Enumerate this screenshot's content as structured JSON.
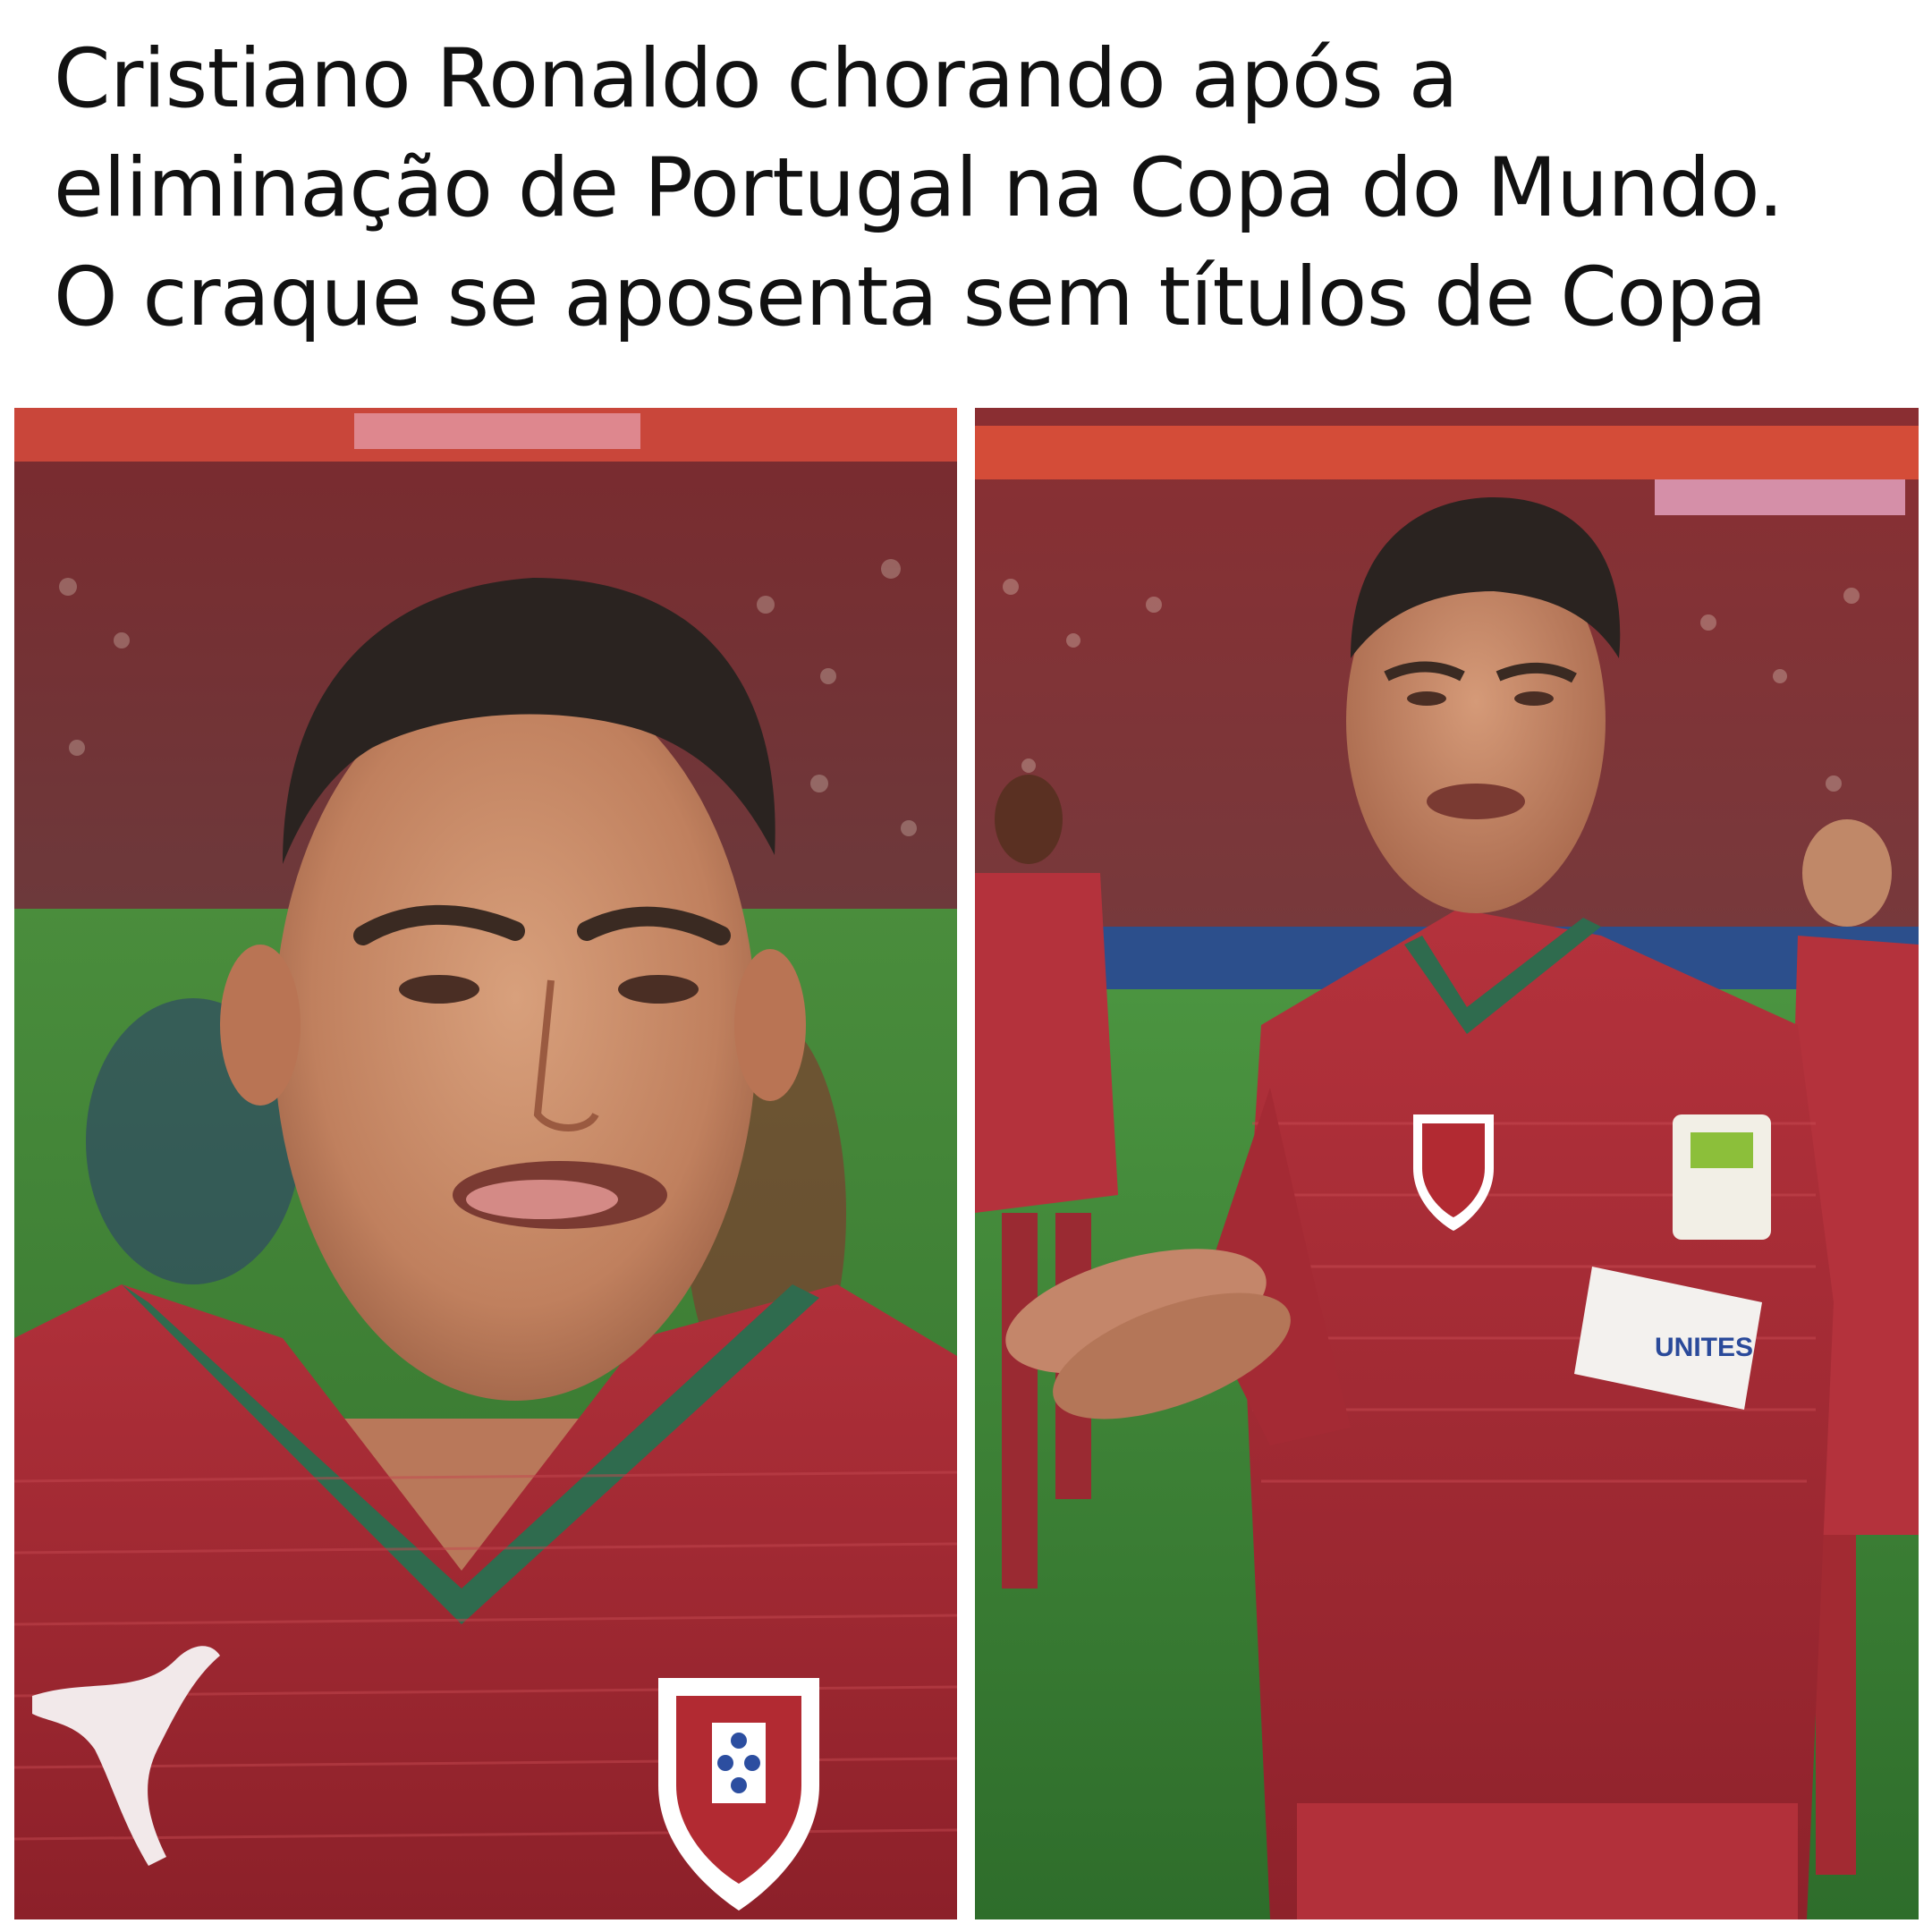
{
  "post": {
    "caption_lines": [
      "Cristiano Ronaldo chorando após a",
      "eliminação de Portugal na Copa do Mundo.",
      "O craque se aposenta sem títulos de Copa"
    ]
  },
  "photos": [
    {
      "subject": "close-up of Cristiano Ronaldo crying in red Portugal jersey",
      "icons": [
        "puma-logo-icon",
        "portugal-crest-icon"
      ]
    },
    {
      "subject": "Cristiano Ronaldo crying and clapping on the pitch wearing captain armband",
      "badge_text": "UNITES",
      "icons": [
        "portugal-crest-icon",
        "captain-armband-icon",
        "sleeve-badge-icon"
      ]
    }
  ],
  "colors": {
    "jersey_red": "#a8282e",
    "collar_green": "#2f6b4e",
    "pitch_green": "#3f8a3a",
    "skin": "#c98a68"
  }
}
